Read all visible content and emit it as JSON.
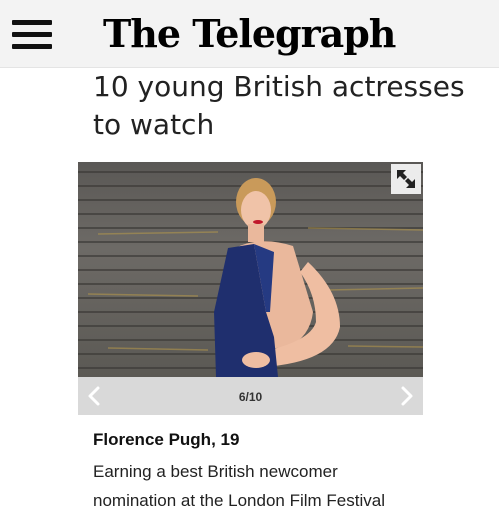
{
  "header": {
    "logo_text": "The Telegraph",
    "menu_icon": "hamburger-menu-icon"
  },
  "article": {
    "headline": "10 young British actresses to watch"
  },
  "gallery": {
    "expand_icon": "expand-icon",
    "prev_icon": "chevron-left-icon",
    "next_icon": "chevron-right-icon",
    "counter": "6/10",
    "caption_title": "Florence Pugh, 19",
    "caption_text": "Earning a best British newcomer nomination at the London Film Festival"
  },
  "colors": {
    "header_bg": "#f3f3f3",
    "nav_bar_bg": "#d9d9d9",
    "dress": "#1f2f6e"
  }
}
